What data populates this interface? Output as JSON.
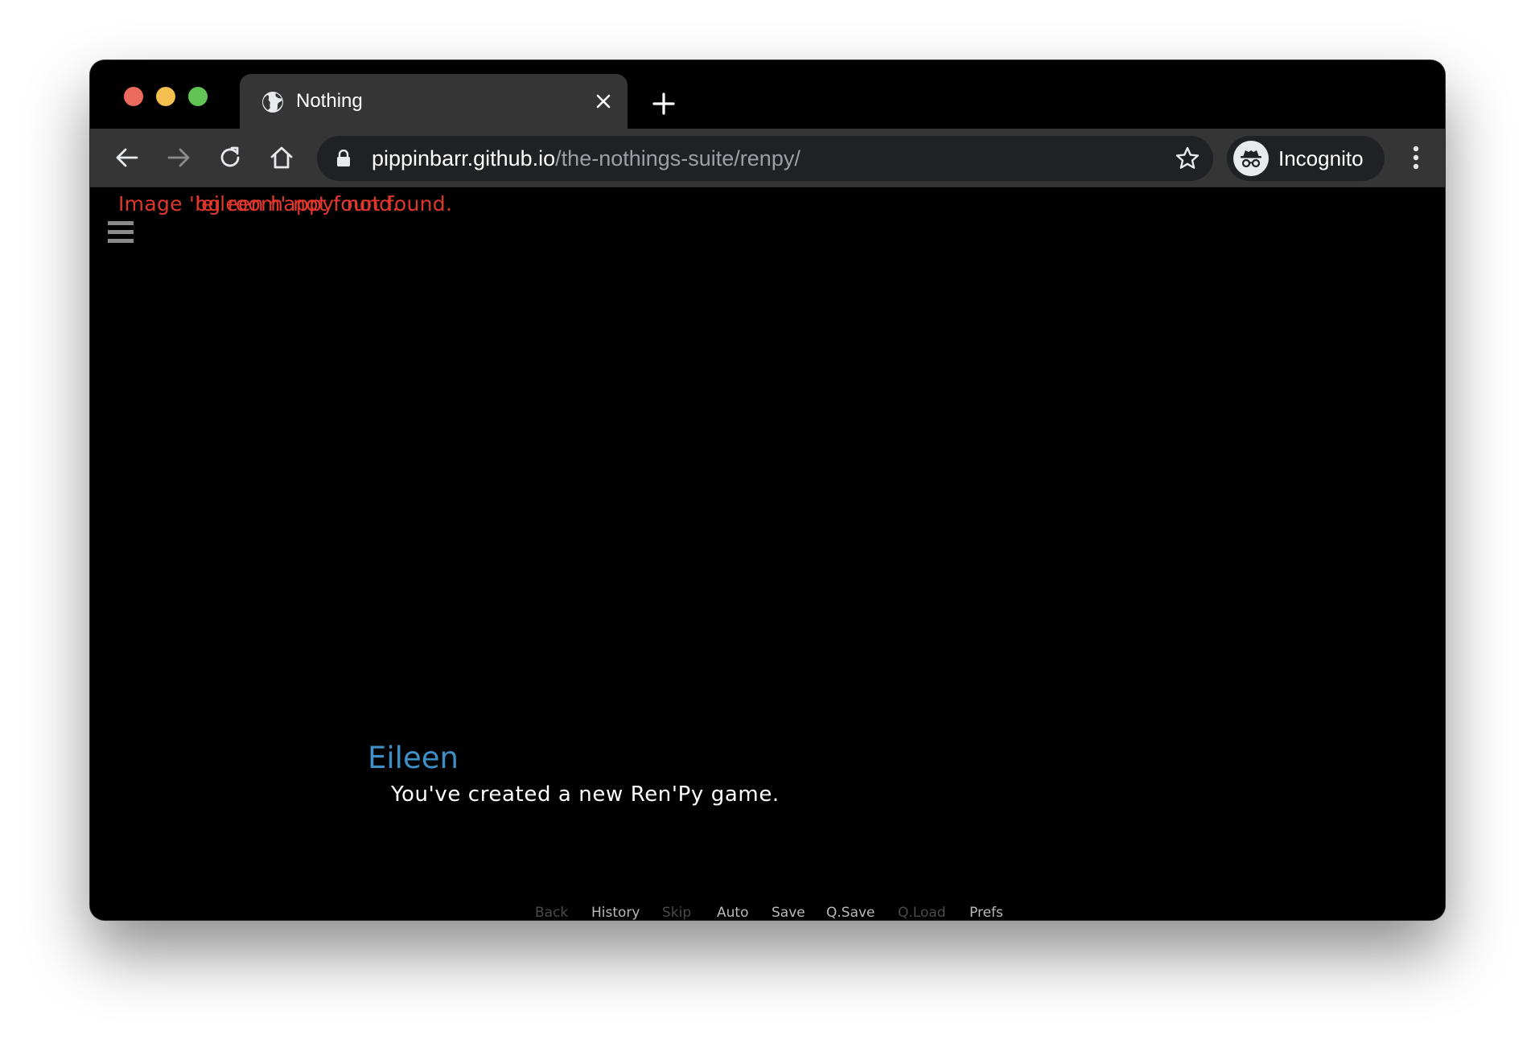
{
  "browser": {
    "tab": {
      "title": "Nothing"
    },
    "address": {
      "host": "pippinbarr.github.io",
      "path": "/the-nothings-suite/renpy/"
    },
    "profile": {
      "label": "Incognito"
    }
  },
  "game": {
    "errors": [
      "Image 'bg room' not found.",
      "'eileen happy' not found."
    ],
    "speaker": "Eileen",
    "dialogue": "You've created a new Ren'Py game.",
    "speaker_color": "#3d8fc6",
    "error_color": "#e0372d"
  },
  "quick_menu": [
    {
      "label": "Back",
      "enabled": false
    },
    {
      "label": "History",
      "enabled": true
    },
    {
      "label": "Skip",
      "enabled": false
    },
    {
      "label": "Auto",
      "enabled": true
    },
    {
      "label": "Save",
      "enabled": true
    },
    {
      "label": "Q.Save",
      "enabled": true
    },
    {
      "label": "Q.Load",
      "enabled": false
    },
    {
      "label": "Prefs",
      "enabled": true
    }
  ],
  "icons": {
    "traffic_lights": [
      "close-dot",
      "minimize-dot",
      "zoom-dot"
    ],
    "tab": [
      "globe-icon",
      "close-icon"
    ],
    "toolbar": [
      "back-arrow-icon",
      "forward-arrow-icon",
      "reload-icon",
      "home-icon",
      "lock-icon",
      "star-icon",
      "incognito-icon",
      "kebab-menu-icon"
    ],
    "game": [
      "hamburger-menu-icon"
    ]
  }
}
